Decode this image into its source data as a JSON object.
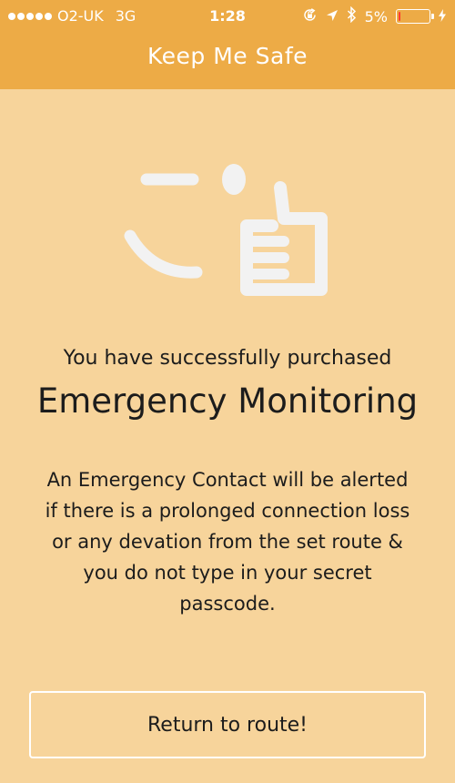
{
  "status_bar": {
    "carrier": "O2-UK",
    "network": "3G",
    "time": "1:28",
    "battery_percent_label": "5%",
    "battery_level": 0.05,
    "icons": [
      "signal-dots-icon",
      "rotation-lock-icon",
      "location-arrow-icon",
      "bluetooth-icon",
      "battery-icon",
      "charging-bolt-icon"
    ]
  },
  "nav": {
    "title": "Keep Me Safe"
  },
  "main": {
    "illustration_icon": "thumbs-up-wink-face-icon",
    "subtitle": "You have successfully purchased",
    "heading": "Emergency Monitoring",
    "body_lines": [
      "An Emergency Contact will be alerted",
      "if there is a prolonged connection loss",
      "or any devation from the set route &",
      "you do not type in your secret",
      "passcode."
    ]
  },
  "action": {
    "button_label": "Return to route!"
  },
  "colors": {
    "header_background": "#edab46",
    "page_background": "#f7d49b",
    "illustration": "#f2f2f2",
    "text": "#1c1c1c",
    "battery_low": "#ff3b30"
  }
}
